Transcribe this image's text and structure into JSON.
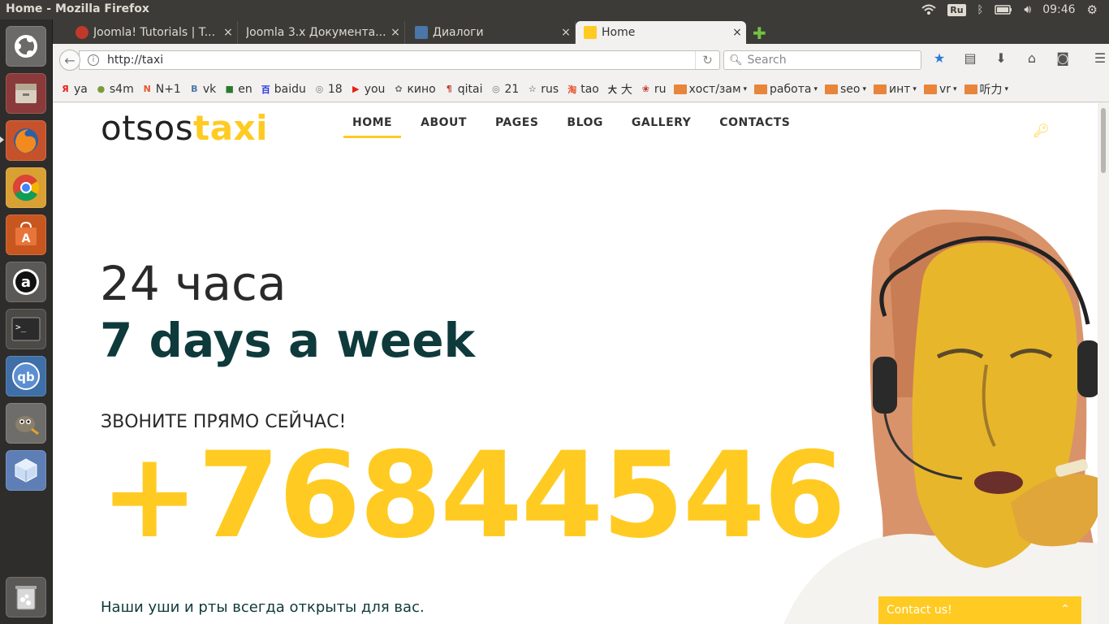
{
  "window": {
    "title": "Home - Mozilla Firefox"
  },
  "system_tray": {
    "keyboard": "Ru",
    "time": "09:46"
  },
  "tabs": [
    {
      "label": "Joomla! Tutorials | T...",
      "fav_color": "#c0392b"
    },
    {
      "label": "Joomla 3.x Документа...",
      "fav_color": ""
    },
    {
      "label": "Диалоги",
      "fav_color": "#4a76a8"
    },
    {
      "label": "Home",
      "fav_color": "#ffcb22"
    }
  ],
  "tab_close": "×",
  "navbar": {
    "url": "http://taxi",
    "search_placeholder": "Search"
  },
  "bookmarks": [
    {
      "label": "ya",
      "icon": "Я",
      "color": "#e62117"
    },
    {
      "label": "s4m",
      "icon": "●",
      "color": "#7a9b3a"
    },
    {
      "label": "N+1",
      "icon": "N",
      "color": "#e8552d"
    },
    {
      "label": "vk",
      "icon": "В",
      "color": "#4a76a8"
    },
    {
      "label": "en",
      "icon": "■",
      "color": "#2b7a2b"
    },
    {
      "label": "baidu",
      "icon": "百",
      "color": "#2932e1"
    },
    {
      "label": "18",
      "icon": "◎",
      "color": "#777777"
    },
    {
      "label": "you",
      "icon": "▶",
      "color": "#e62117"
    },
    {
      "label": "кино",
      "icon": "✿",
      "color": "#777777"
    },
    {
      "label": "qitai",
      "icon": "¶",
      "color": "#c0392b"
    },
    {
      "label": "21",
      "icon": "◎",
      "color": "#777777"
    },
    {
      "label": "rus",
      "icon": "☆",
      "color": "#333333"
    },
    {
      "label": "tao",
      "icon": "淘",
      "color": "#e8552d"
    },
    {
      "label": "大",
      "icon": "大",
      "color": "#333333"
    },
    {
      "label": "ru",
      "icon": "❀",
      "color": "#c0392b"
    }
  ],
  "bookmark_folders": [
    {
      "label": "хост/зам"
    },
    {
      "label": "работа"
    },
    {
      "label": "seo"
    },
    {
      "label": "инт"
    },
    {
      "label": "vr"
    },
    {
      "label": "听力"
    }
  ],
  "site": {
    "logo_part1": "otsos",
    "logo_part2": "taxi",
    "menu": [
      "HOME",
      "ABOUT",
      "PAGES",
      "BLOG",
      "GALLERY",
      "CONTACTS"
    ],
    "headline1": "24 часа",
    "headline2": "7 days a week",
    "cta": "ЗВОНИТЕ ПРЯМО СЕЙЧАС!",
    "phone": "+76844546",
    "tagline": "Наши уши и рты всегда открыты для вас.",
    "contact_bar": "Contact us!"
  },
  "colors": {
    "accent": "#ffcb22",
    "dark_teal": "#0f3a3b"
  }
}
